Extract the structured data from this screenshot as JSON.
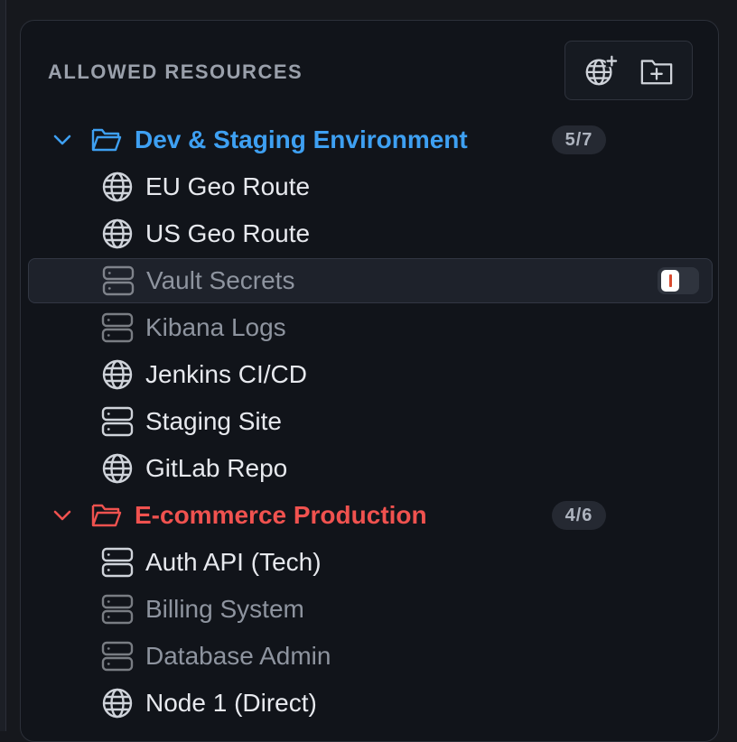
{
  "panel": {
    "title": "ALLOWED RESOURCES",
    "toolbar": [
      {
        "icon": "globe-plus-icon"
      },
      {
        "icon": "folder-plus-icon"
      }
    ]
  },
  "colors": {
    "dev_group": "#3ea0f2",
    "prod_group": "#f0524f",
    "icon": "#cfd3da",
    "text": "#e7e9ee",
    "muted_text": "#8e949f"
  },
  "groups": [
    {
      "label": "Dev & Staging Environment",
      "count": "5/7",
      "expanded": true,
      "items": [
        {
          "label": "EU Geo Route",
          "icon": "globe-icon",
          "enabled": true
        },
        {
          "label": "US Geo Route",
          "icon": "globe-icon",
          "enabled": true
        },
        {
          "label": "Vault Secrets",
          "icon": "server-icon",
          "enabled": false,
          "selected": true
        },
        {
          "label": "Kibana Logs",
          "icon": "server-icon",
          "enabled": false
        },
        {
          "label": "Jenkins CI/CD",
          "icon": "globe-icon",
          "enabled": true
        },
        {
          "label": "Staging Site",
          "icon": "server-icon",
          "enabled": true
        },
        {
          "label": "GitLab Repo",
          "icon": "globe-icon",
          "enabled": true
        }
      ]
    },
    {
      "label": "E-commerce Production",
      "count": "4/6",
      "expanded": true,
      "items": [
        {
          "label": "Auth API (Tech)",
          "icon": "server-icon",
          "enabled": true
        },
        {
          "label": "Billing System",
          "icon": "server-icon",
          "enabled": false
        },
        {
          "label": "Database Admin",
          "icon": "server-icon",
          "enabled": false
        },
        {
          "label": "Node 1 (Direct)",
          "icon": "globe-icon",
          "enabled": true
        }
      ]
    }
  ]
}
